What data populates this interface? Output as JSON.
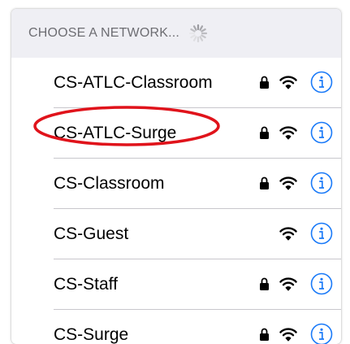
{
  "header": {
    "label": "CHOOSE A NETWORK..."
  },
  "networks": [
    {
      "name": "CS-ATLC-Classroom",
      "secured": true
    },
    {
      "name": "CS-ATLC-Surge",
      "secured": true
    },
    {
      "name": "CS-Classroom",
      "secured": true
    },
    {
      "name": "CS-Guest",
      "secured": false
    },
    {
      "name": "CS-Staff",
      "secured": true
    },
    {
      "name": "CS-Surge",
      "secured": true
    }
  ],
  "colors": {
    "accent": "#1a7af8",
    "annotation": "#e0131b",
    "header_bg": "#efeff4",
    "header_text": "#6d6d72",
    "separator": "#c8c7cc"
  },
  "icons": {
    "loading": "activity-spinner-icon",
    "lock": "lock-icon",
    "wifi": "wifi-icon",
    "info": "info-icon"
  },
  "annotation": {
    "type": "red-ellipse",
    "target": "CS-ATLC-Surge"
  }
}
